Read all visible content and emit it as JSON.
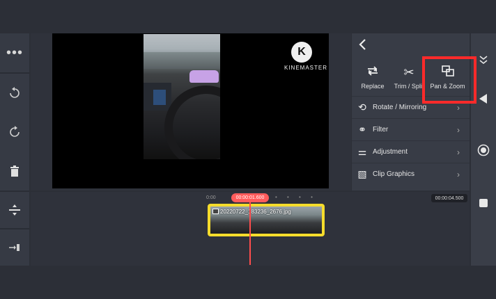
{
  "preview": {
    "watermark_text": "KINEMASTER",
    "watermark_logo": "K"
  },
  "options_panel": {
    "tools": [
      {
        "icon": "replace-icon",
        "label": "Replace"
      },
      {
        "icon": "scissors-icon",
        "label": "Trim / Split"
      },
      {
        "icon": "pan-zoom-icon",
        "label": "Pan & Zoom"
      }
    ],
    "items": [
      {
        "icon": "rotate-icon",
        "label": "Rotate / Mirroring"
      },
      {
        "icon": "filter-icon",
        "label": "Filter"
      },
      {
        "icon": "adjustment-icon",
        "label": "Adjustment"
      },
      {
        "icon": "clip-graphics-icon",
        "label": "Clip Graphics"
      }
    ],
    "highlight_color": "#ff2a2a"
  },
  "timeline": {
    "start_time": "0:00",
    "playhead_time": "00:00:01.600",
    "end_time": "00:00:04.500",
    "clip_name": "20220722_183236_2676.jpg",
    "clip_border_color": "#f5dc2c",
    "playhead_color": "#ff4d4d"
  }
}
